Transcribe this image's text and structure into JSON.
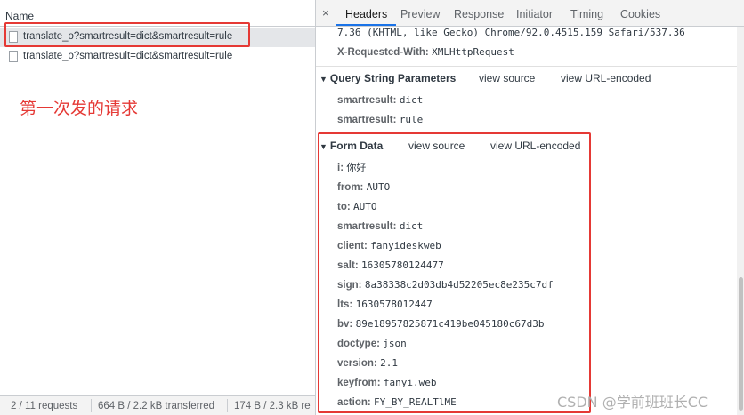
{
  "requests_panel": {
    "header": "Name",
    "rows": [
      {
        "name": "translate_o?smartresult=dict&smartresult=rule"
      },
      {
        "name": "translate_o?smartresult=dict&smartresult=rule"
      }
    ],
    "annotation": "第一次发的请求",
    "status": {
      "requests": "2 / 11 requests",
      "transferred": "664 B / 2.2 kB transferred",
      "resources": "174 B / 2.3 kB re"
    }
  },
  "details": {
    "tabs": [
      "Headers",
      "Preview",
      "Response",
      "Initiator",
      "Timing",
      "Cookies"
    ],
    "close_glyph": "×",
    "ua_tail": "7.36 (KHTML, like Gecko) Chrome/92.0.4515.159 Safari/537.36",
    "x_requested_with": {
      "key": "X-Requested-With:",
      "value": "XMLHttpRequest"
    },
    "query": {
      "title": "Query String Parameters",
      "view_source": "view source",
      "view_url": "view URL-encoded",
      "params": [
        {
          "key": "smartresult:",
          "value": "dict"
        },
        {
          "key": "smartresult:",
          "value": "rule"
        }
      ]
    },
    "form": {
      "title": "Form Data",
      "view_source": "view source",
      "view_url": "view URL-encoded",
      "params": [
        {
          "key": "i:",
          "value": "你好"
        },
        {
          "key": "from:",
          "value": "AUTO"
        },
        {
          "key": "to:",
          "value": "AUTO"
        },
        {
          "key": "smartresult:",
          "value": "dict"
        },
        {
          "key": "client:",
          "value": "fanyideskweb"
        },
        {
          "key": "salt:",
          "value": "16305780124477"
        },
        {
          "key": "sign:",
          "value": "8a38338c2d03db4d52205ec8e235c7df"
        },
        {
          "key": "lts:",
          "value": "1630578012447"
        },
        {
          "key": "bv:",
          "value": "89e18957825871c419be045180c67d3b"
        },
        {
          "key": "doctype:",
          "value": "json"
        },
        {
          "key": "version:",
          "value": "2.1"
        },
        {
          "key": "keyfrom:",
          "value": "fanyi.web"
        },
        {
          "key": "action:",
          "value": "FY_BY_REALTlME"
        }
      ]
    }
  },
  "watermark": "CSDN @学前班班长CC",
  "colors": {
    "highlight": "#e53935",
    "active_tab": "#1a73e8"
  }
}
